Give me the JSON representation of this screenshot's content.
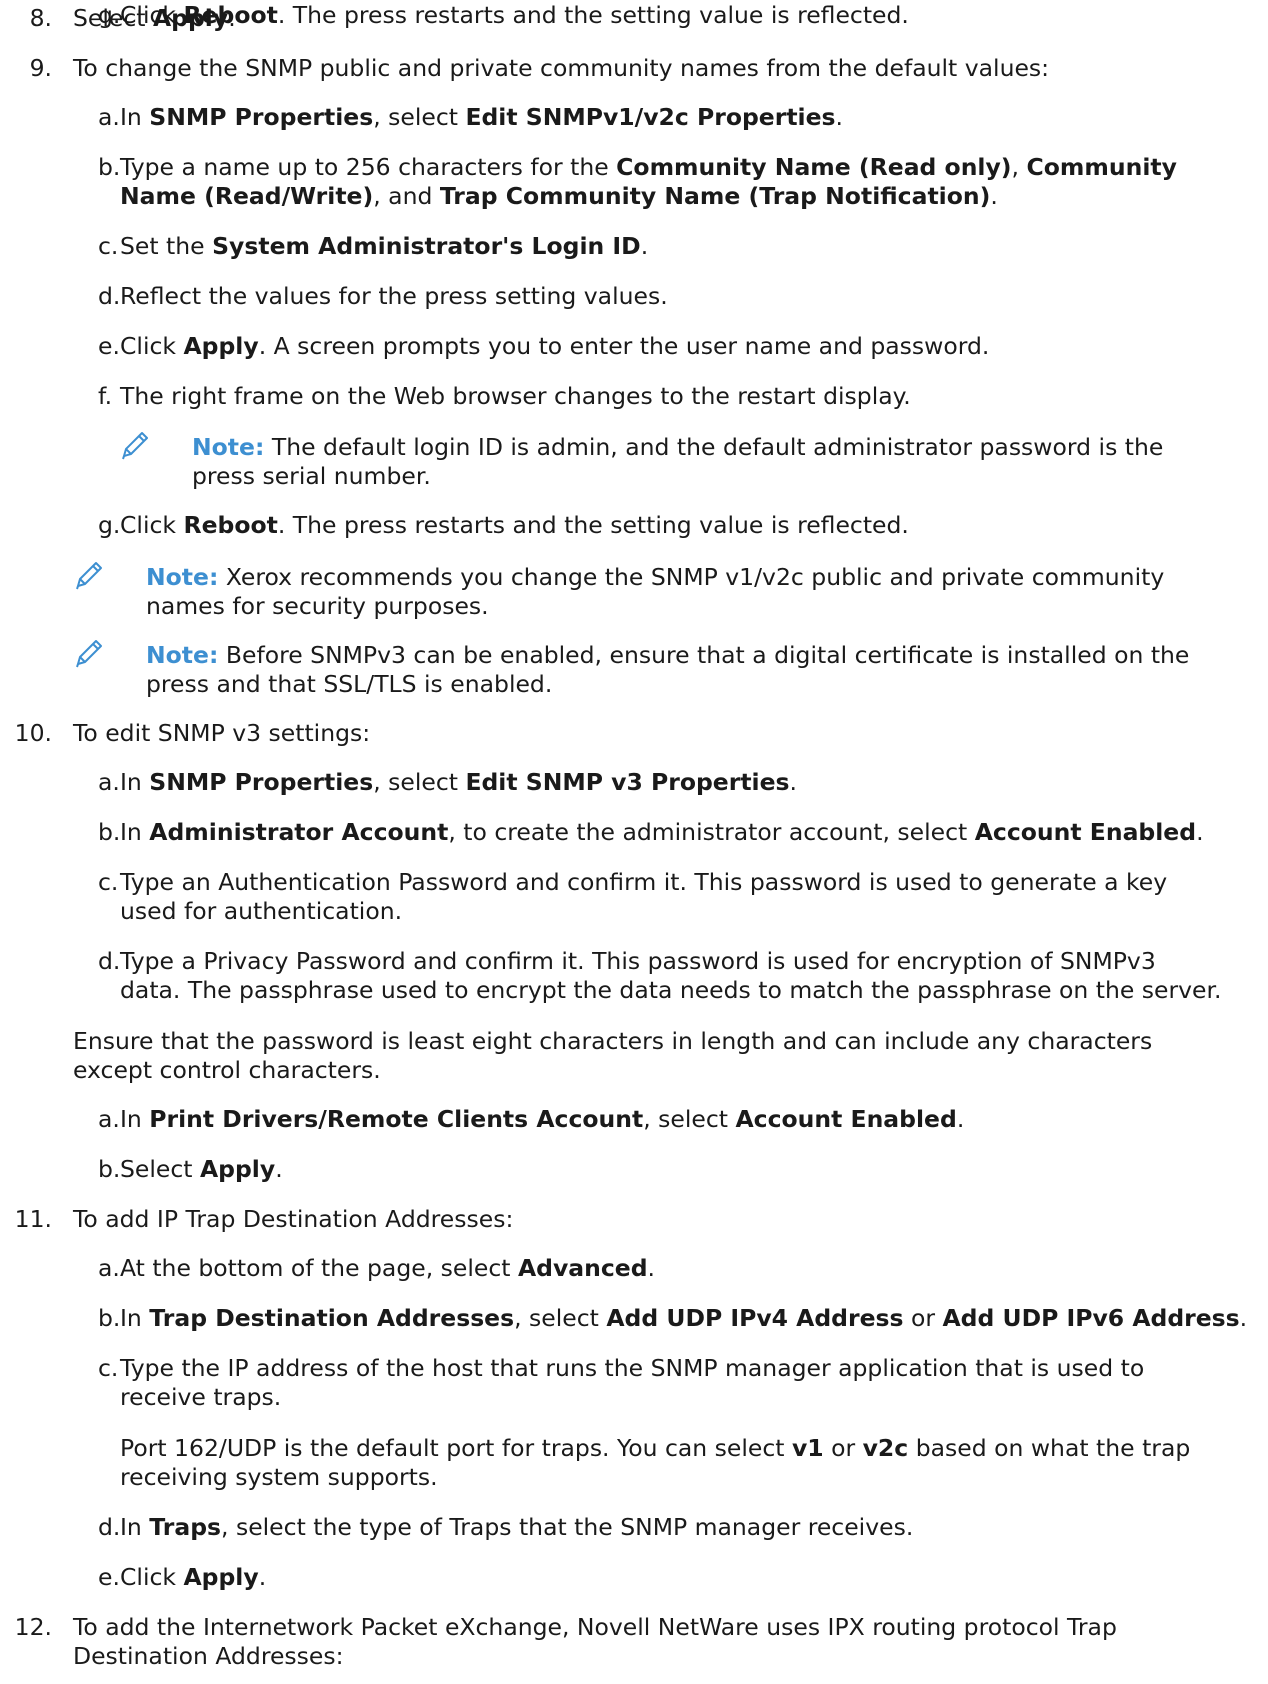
{
  "colors": {
    "note_accent": "#3d8fd1",
    "text": "#1a1a1a"
  },
  "icons": {
    "note": "pencil-icon"
  },
  "steps": [
    {
      "number": "8.",
      "segments": [
        [
          "Select ",
          false
        ],
        [
          "Apply",
          true
        ],
        [
          ".",
          false
        ]
      ]
    },
    {
      "number": "9.",
      "segments": [
        [
          "To change the SNMP public and private community names from the default values:",
          false
        ]
      ],
      "substeps": [
        {
          "letter": "a.",
          "lines": [
            [
              [
                "In ",
                false
              ],
              [
                "SNMP Properties",
                true
              ],
              [
                ", select ",
                false
              ],
              [
                "Edit SNMPv1/v2c Properties",
                true
              ],
              [
                ".",
                false
              ]
            ]
          ]
        },
        {
          "letter": "b.",
          "lines": [
            [
              [
                "Type a name up to 256 characters for the ",
                false
              ],
              [
                "Community Name (Read only)",
                true
              ],
              [
                ", ",
                false
              ],
              [
                "Community",
                true
              ]
            ],
            [
              [
                "Name (Read/Write)",
                true
              ],
              [
                ", and ",
                false
              ],
              [
                "Trap Community Name (Trap Notification)",
                true
              ],
              [
                ".",
                false
              ]
            ]
          ]
        },
        {
          "letter": "c.",
          "lines": [
            [
              [
                "Set the ",
                false
              ],
              [
                "System Administrator's Login ID",
                true
              ],
              [
                ".",
                false
              ]
            ]
          ]
        },
        {
          "letter": "d.",
          "lines": [
            [
              [
                "Reflect the values for the press setting values.",
                false
              ]
            ]
          ]
        },
        {
          "letter": "e.",
          "lines": [
            [
              [
                "Click ",
                false
              ],
              [
                "Apply",
                true
              ],
              [
                ". A screen prompts you to enter the user name and password.",
                false
              ]
            ]
          ]
        },
        {
          "letter": "f.",
          "lines": [
            [
              [
                "The right frame on the Web browser changes to the restart display.",
                false
              ]
            ]
          ]
        },
        {
          "letter": "g.",
          "lines": [
            [
              [
                "Click ",
                false
              ],
              [
                "Reboot",
                true
              ],
              [
                ". The press restarts and the setting value is reflected.",
                false
              ]
            ]
          ]
        }
      ]
    },
    {
      "number": "10.",
      "segments": [
        [
          "To edit SNMP v3 settings:",
          false
        ]
      ],
      "substeps": [
        {
          "letter": "a.",
          "lines": [
            [
              [
                "In ",
                false
              ],
              [
                "SNMP Properties",
                true
              ],
              [
                ", select ",
                false
              ],
              [
                "Edit SNMP v3 Properties",
                true
              ],
              [
                ".",
                false
              ]
            ]
          ]
        },
        {
          "letter": "b.",
          "lines": [
            [
              [
                "In ",
                false
              ],
              [
                "Administrator Account",
                true
              ],
              [
                ", to create the administrator account, select ",
                false
              ],
              [
                "Account Enabled",
                true
              ],
              [
                ".",
                false
              ]
            ]
          ]
        },
        {
          "letter": "c.",
          "lines": [
            [
              [
                "Type an Authentication Password and confirm it. This password is used to generate a key",
                false
              ]
            ],
            [
              [
                "used for authentication.",
                false
              ]
            ]
          ]
        },
        {
          "letter": "d.",
          "lines": [
            [
              [
                "Type a Privacy Password and confirm it. This password is used for encryption of SNMPv3",
                false
              ]
            ],
            [
              [
                "data. The passphrase used to encrypt the data needs to match the passphrase on the server.",
                false
              ]
            ]
          ]
        }
      ],
      "paragraph": [
        "Ensure that the password is least eight characters in length and can include any characters",
        "except control characters."
      ],
      "substeps2": [
        {
          "letter": "a.",
          "lines": [
            [
              [
                "In ",
                false
              ],
              [
                "Print Drivers/Remote Clients Account",
                true
              ],
              [
                ", select ",
                false
              ],
              [
                "Account Enabled",
                true
              ],
              [
                ".",
                false
              ]
            ]
          ]
        },
        {
          "letter": "b.",
          "lines": [
            [
              [
                "Select ",
                false
              ],
              [
                "Apply",
                true
              ],
              [
                ".",
                false
              ]
            ]
          ]
        }
      ]
    },
    {
      "number": "11.",
      "segments": [
        [
          "To add IP Trap Destination Addresses:",
          false
        ]
      ],
      "substeps": [
        {
          "letter": "a.",
          "lines": [
            [
              [
                "At the bottom of the page, select ",
                false
              ],
              [
                "Advanced",
                true
              ],
              [
                ".",
                false
              ]
            ]
          ]
        },
        {
          "letter": "b.",
          "lines": [
            [
              [
                "In ",
                false
              ],
              [
                "Trap Destination Addresses",
                true
              ],
              [
                ", select ",
                false
              ],
              [
                "Add UDP IPv4 Address",
                true
              ],
              [
                " or ",
                false
              ],
              [
                "Add UDP IPv6 Address",
                true
              ],
              [
                ".",
                false
              ]
            ]
          ]
        },
        {
          "letter": "c.",
          "lines": [
            [
              [
                "Type the IP address of the host that runs the SNMP manager application that is used to",
                false
              ]
            ],
            [
              [
                "receive traps.",
                false
              ]
            ]
          ]
        },
        {
          "letter": "",
          "lines": [
            [
              [
                "Port 162/UDP is the default port for traps. You can select ",
                false
              ],
              [
                "v1",
                true
              ],
              [
                " or ",
                false
              ],
              [
                "v2c",
                true
              ],
              [
                " based on what the trap",
                false
              ]
            ],
            [
              [
                "receiving system supports.",
                false
              ]
            ]
          ]
        },
        {
          "letter": "d.",
          "lines": [
            [
              [
                "In ",
                false
              ],
              [
                "Traps",
                true
              ],
              [
                ", select the type of Traps that the SNMP manager receives.",
                false
              ]
            ]
          ]
        },
        {
          "letter": "e.",
          "lines": [
            [
              [
                "Click ",
                false
              ],
              [
                "Apply",
                true
              ],
              [
                ".",
                false
              ]
            ]
          ]
        }
      ]
    },
    {
      "number": "12.",
      "lines": [
        "To add the Internetwork Packet eXchange, Novell NetWare uses IPX routing protocol Trap",
        "Destination Addresses:"
      ]
    }
  ],
  "notes": [
    {
      "label": "Note:",
      "lines": [
        " The default login ID is admin, and the default administrator password is the",
        "press serial number."
      ]
    },
    {
      "label": "Note:",
      "lines": [
        " Xerox recommends you change the SNMP v1/v2c public and private community",
        "names for security purposes."
      ]
    },
    {
      "label": "Note:",
      "lines": [
        " Before SNMPv3 can be enabled, ensure that a digital certificate is installed on the",
        "press and that SSL/TLS is enabled."
      ]
    }
  ]
}
